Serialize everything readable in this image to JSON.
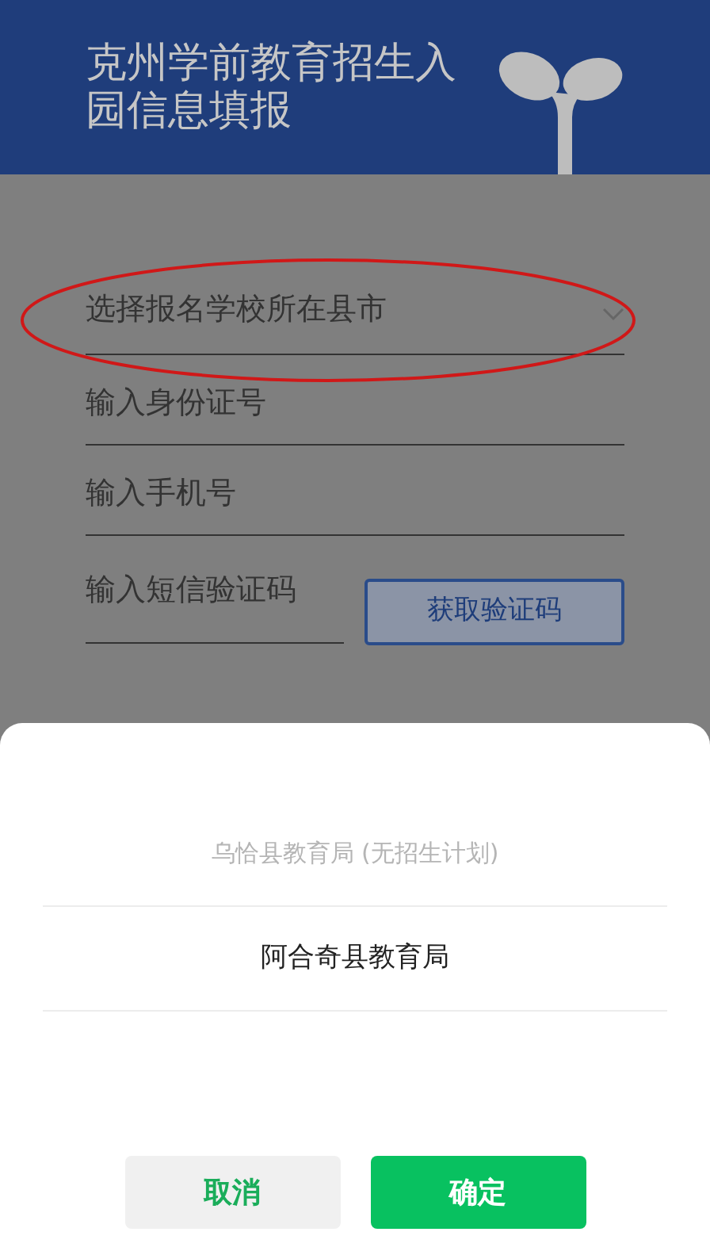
{
  "header": {
    "title": "克州学前教育招生入园信息填报"
  },
  "form": {
    "fields": [
      {
        "kind": "select",
        "placeholder": "选择报名学校所在县市"
      },
      {
        "kind": "text",
        "placeholder": "输入身份证号"
      },
      {
        "kind": "text",
        "placeholder": "输入手机号"
      },
      {
        "kind": "code",
        "placeholder": "输入短信验证码",
        "button": "获取验证码"
      }
    ]
  },
  "picker": {
    "options": [
      {
        "label": "乌恰县教育局 (无招生计划)",
        "selected": false
      },
      {
        "label": "阿合奇县教育局",
        "selected": true
      }
    ],
    "cancel": "取消",
    "confirm": "确定"
  }
}
